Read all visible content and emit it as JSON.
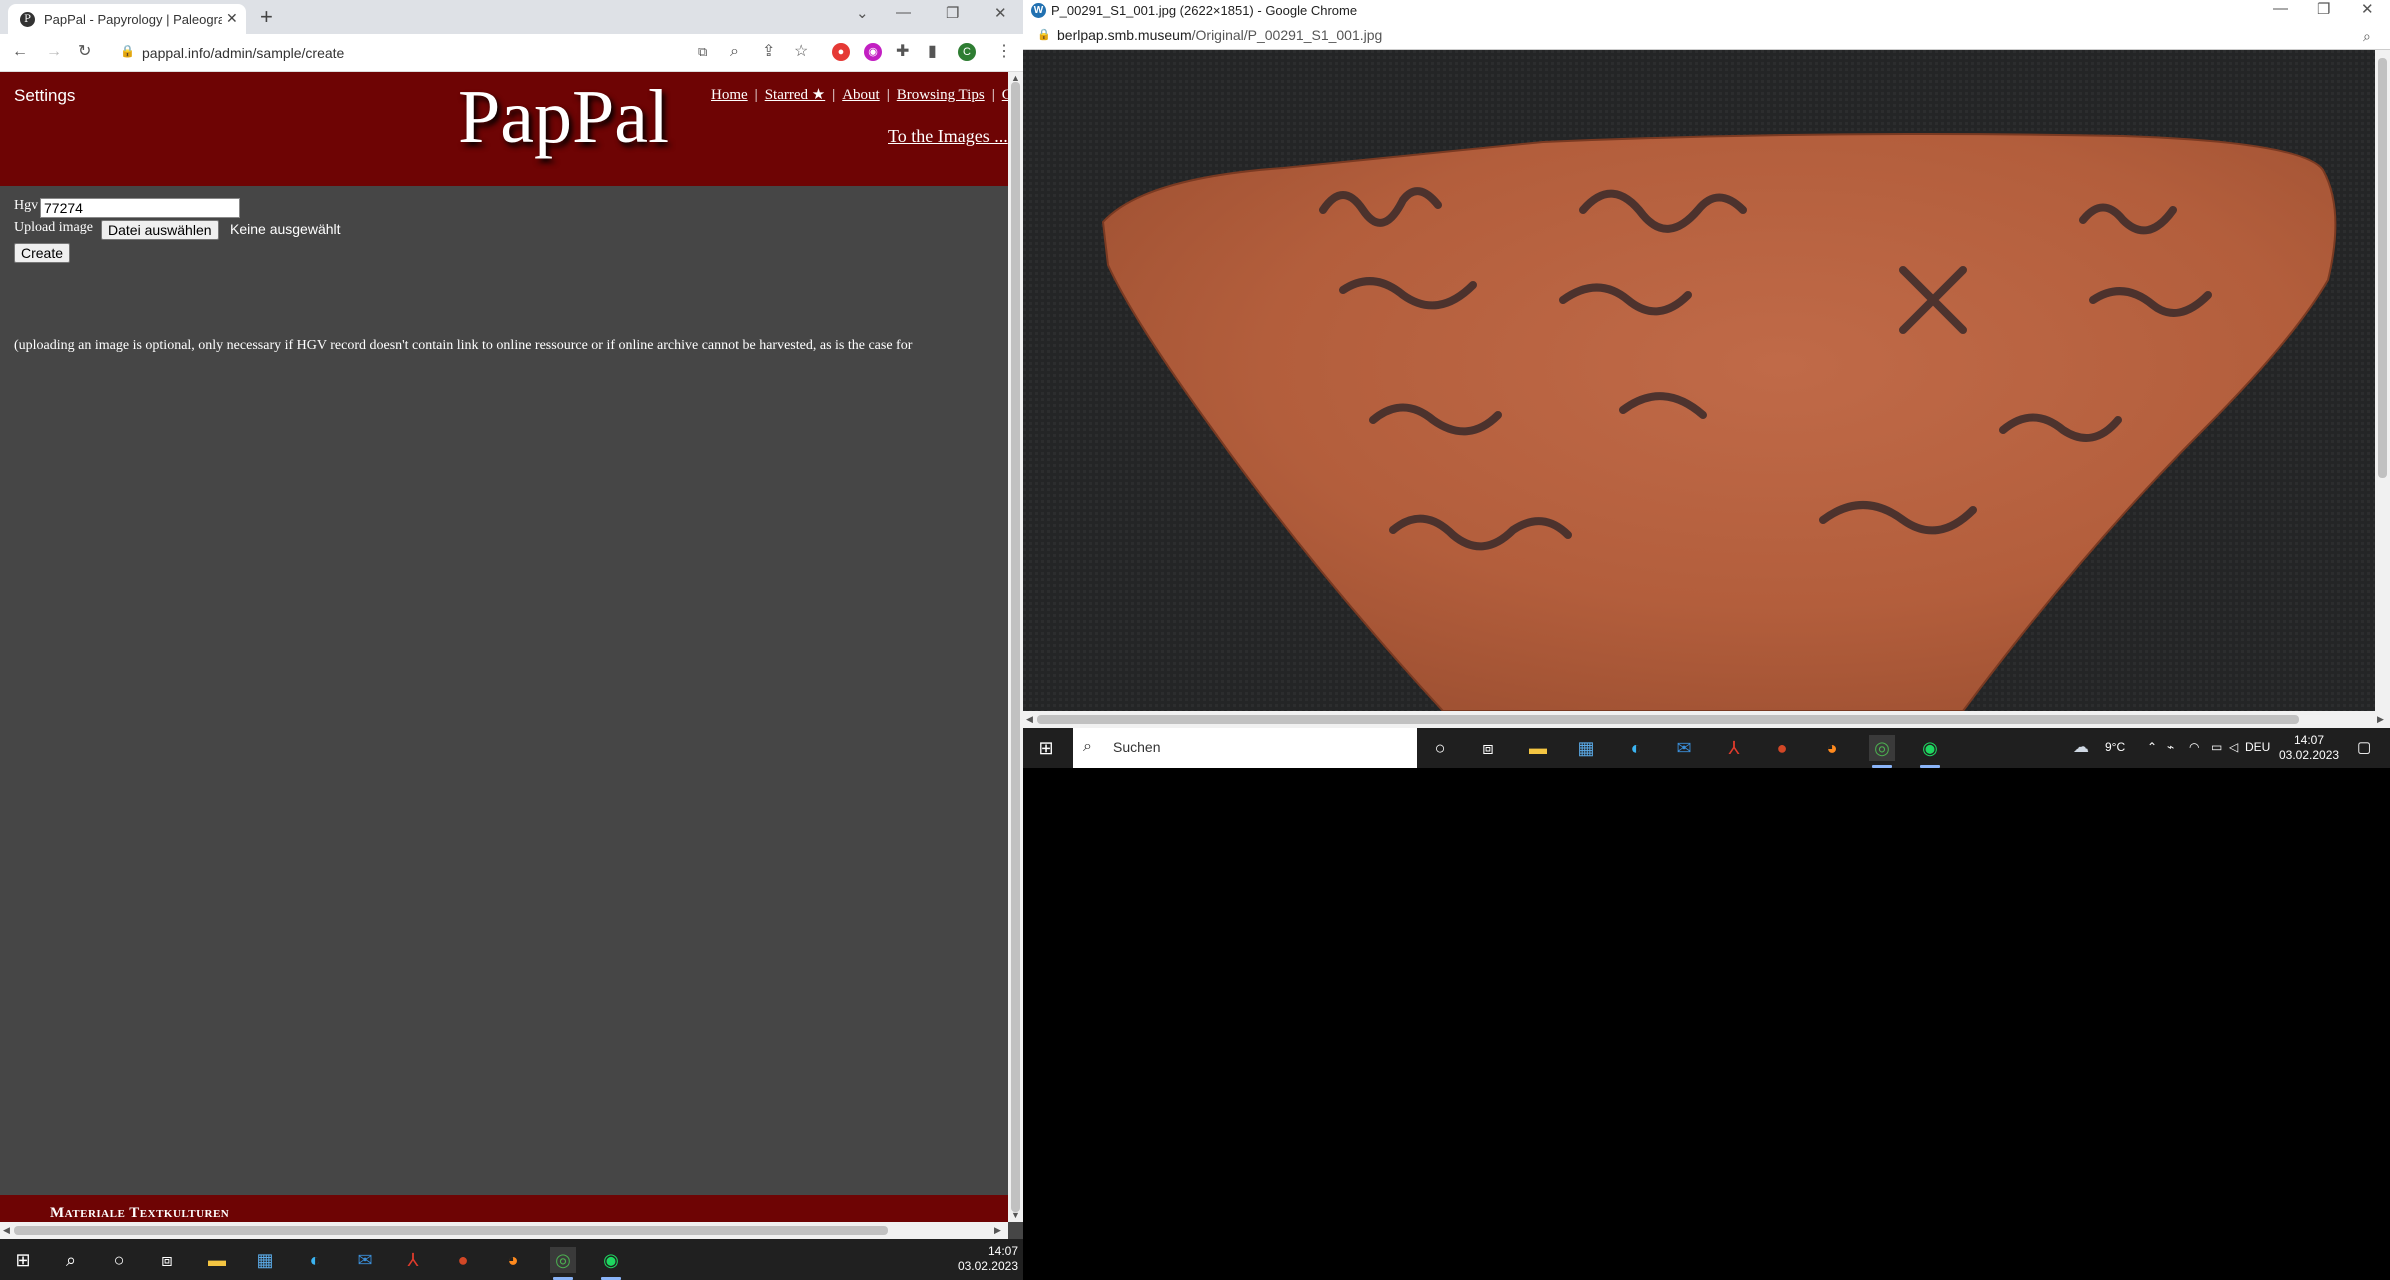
{
  "left_window": {
    "tab_title": "PapPal - Papyrology | Paleography",
    "tab_close": "✕",
    "new_tab": "+",
    "url": "pappal.info/admin/sample/create"
  },
  "page": {
    "settings_label": "Settings",
    "logo": "PapPal",
    "nav": {
      "home": "Home",
      "starred": "Starred ★",
      "about": "About",
      "browsing_tips": "Browsing Tips",
      "more": "C"
    },
    "to_images": "To the Images ...",
    "form": {
      "hgv_label": "Hgv",
      "hgv_value": "77274",
      "upload_label": "Upload image",
      "file_button": "Datei auswählen",
      "no_file": "Keine ausgewählt",
      "create_button": "Create",
      "note": "(uploading an image is optional, only necessary if HGV record doesn't contain link to online ressource or if online archive cannot be harvested, as is the case for"
    },
    "footer_text": "Materiale Textkulturen"
  },
  "left_taskbar": {
    "time": "14:07",
    "date": "03.02.2023"
  },
  "right_window": {
    "title": "P_00291_S1_001.jpg (2622×1851) - Google Chrome",
    "url_host": "berlpap.smb.museum",
    "url_path": "/Original/P_00291_S1_001.jpg"
  },
  "right_taskbar": {
    "search_placeholder": "Suchen",
    "weather": "9°C",
    "language": "DEU",
    "time": "14:07",
    "date": "03.02.2023"
  },
  "colors": {
    "banner": "#6e0404",
    "page_bg": "#464646",
    "ostracon": "#b5613f"
  }
}
